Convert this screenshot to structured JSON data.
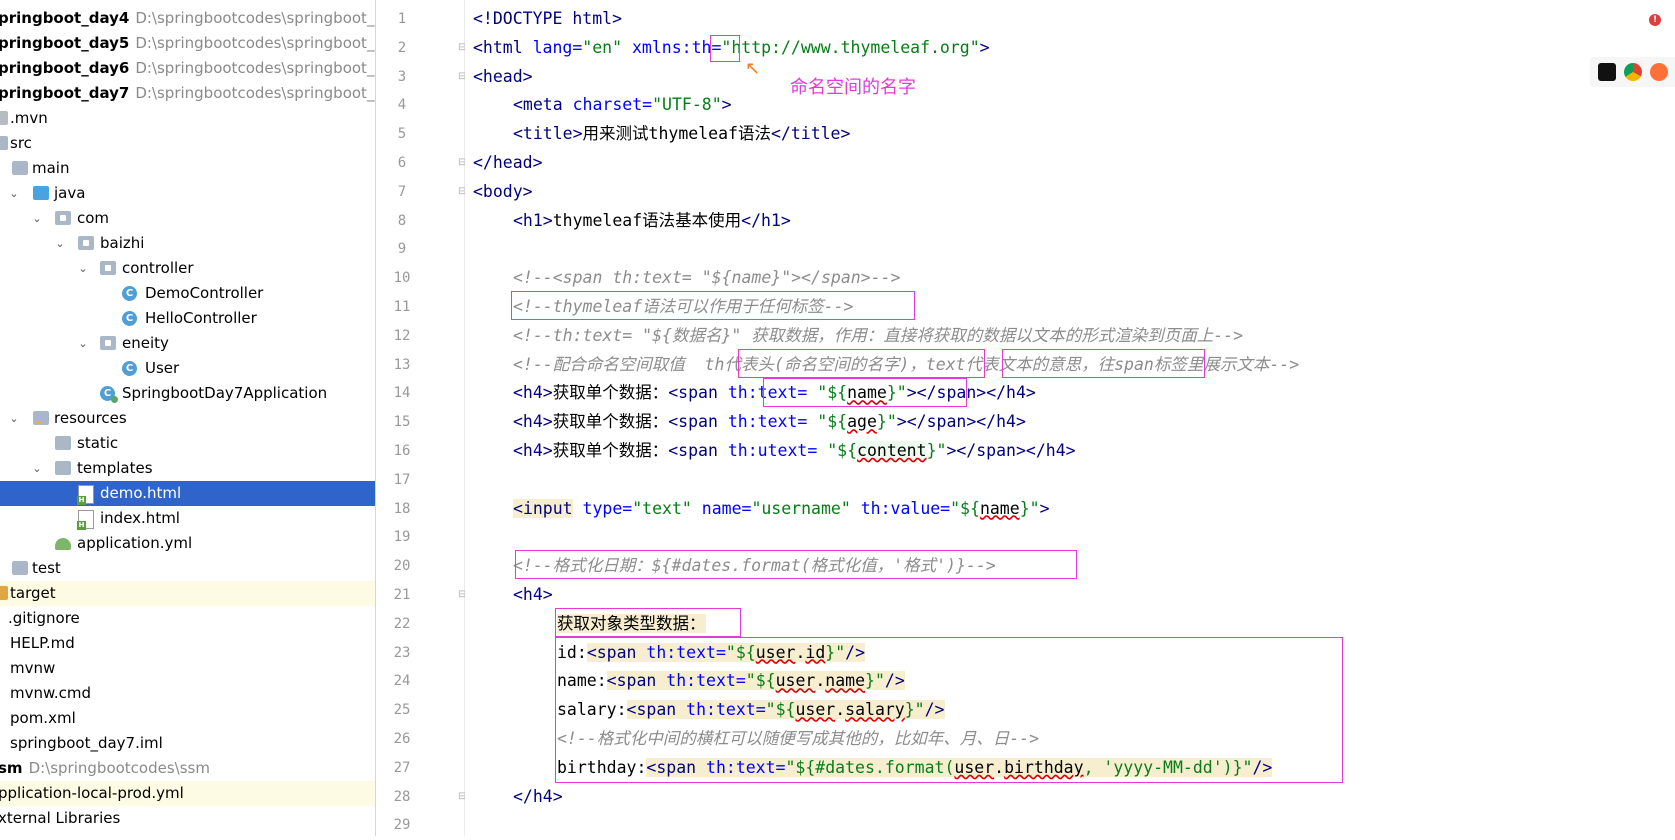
{
  "sidebar": {
    "projects": [
      {
        "name": "pringboot_day4",
        "path": "D:\\springbootcodes\\springboot_day"
      },
      {
        "name": "pringboot_day5",
        "path": "D:\\springbootcodes\\springboot_day"
      },
      {
        "name": "pringboot_day6",
        "path": "D:\\springbootcodes\\springboot_day"
      },
      {
        "name": "pringboot_day7",
        "path": "D:\\springbootcodes\\springboot_day"
      }
    ],
    "tree": [
      {
        "label": ".mvn"
      },
      {
        "label": "src"
      },
      {
        "label": "main"
      },
      {
        "label": "java"
      },
      {
        "label": "com"
      },
      {
        "label": "baizhi"
      },
      {
        "label": "controller"
      },
      {
        "label": "DemoController"
      },
      {
        "label": "HelloController"
      },
      {
        "label": "eneity"
      },
      {
        "label": "User"
      },
      {
        "label": "SpringbootDay7Application"
      },
      {
        "label": "resources"
      },
      {
        "label": "static"
      },
      {
        "label": "templates"
      },
      {
        "label": "demo.html"
      },
      {
        "label": "index.html"
      },
      {
        "label": "application.yml"
      },
      {
        "label": "test"
      },
      {
        "label": "target"
      },
      {
        "label": ".gitignore"
      },
      {
        "label": "HELP.md"
      },
      {
        "label": "mvnw"
      },
      {
        "label": "mvnw.cmd"
      },
      {
        "label": "pom.xml"
      },
      {
        "label": "springboot_day7.iml"
      }
    ],
    "ssm": {
      "name": "sm",
      "path": "D:\\springbootcodes\\ssm"
    },
    "app_local": "pplication-local-prod.yml",
    "ext_libs": "xternal Libraries"
  },
  "editor": {
    "line_numbers": [
      "1",
      "2",
      "3",
      "4",
      "5",
      "6",
      "7",
      "8",
      "9",
      "10",
      "11",
      "12",
      "13",
      "14",
      "15",
      "16",
      "17",
      "18",
      "19",
      "20",
      "21",
      "22",
      "23",
      "24",
      "25",
      "26",
      "27",
      "28",
      "29"
    ],
    "annotation": "命名空间的名字",
    "lines": {
      "l1a": "<!DOCTYPE ",
      "l1b": "html",
      "l1c": ">",
      "l2a": "<html ",
      "l2b": "lang=",
      "l2c": "\"en\"",
      "l2d": " xmlns:",
      "l2e": "th",
      "l2f": "=",
      "l2g": "\"http://www.thymeleaf.org\"",
      "l2h": ">",
      "l3": "<head>",
      "l4a": "<meta ",
      "l4b": "charset=",
      "l4c": "\"UTF-8\"",
      "l4d": ">",
      "l5a": "<title>",
      "l5b": "用来测试thymeleaf语法",
      "l5c": "</title>",
      "l6": "</head>",
      "l7": "<body>",
      "l8a": "<h1>",
      "l8b": "thymeleaf语法基本使用",
      "l8c": "</h1>",
      "l10": "<!--<span th:text= \"${name}\"></span>-->",
      "l11": "<!--thymeleaf语法可以作用于任何标签-->",
      "l12": "<!--th:text= \"${数据名}\" 获取数据，作用：直接将获取的数据以文本的形式渲染到页面上-->",
      "l13a": "<!--配合命名空间取值  ",
      "l13b": "th代表头(命名空间的名字)",
      "l13c": "，",
      "l13d": "text代表文本的意思，",
      "l13e": "往span标签里展示文本-->",
      "l14a": "<h4>",
      "l14b": "获取单个数据：",
      "l14c": "<span ",
      "l14d": "th:text=",
      "l14e": " \"${",
      "l14f": "name",
      "l14g": "}\"",
      "l14h": "></span></h4>",
      "l15a": "<h4>",
      "l15b": "获取单个数据：",
      "l15c": "<span ",
      "l15d": "th:text=",
      "l15e": " \"${",
      "l15f": "age",
      "l15g": "}\"",
      "l15h": "></span></h4>",
      "l16a": "<h4>",
      "l16b": "获取单个数据：",
      "l16c": "<span ",
      "l16d": "th:utext=",
      "l16e": " \"${",
      "l16f": "content",
      "l16g": "}\"",
      "l16h": "></span></h4>",
      "l18a": "<",
      "l18b": "input",
      "l18c": " type=",
      "l18d": "\"text\"",
      "l18e": " name=",
      "l18f": "\"username\"",
      "l18g": " th:value=",
      "l18h": "\"${",
      "l18i": "name",
      "l18j": "}\"",
      "l18k": ">",
      "l20": "<!--格式化日期：${#dates.format(格式化值，'格式')}-->",
      "l21": "<h4>",
      "l22": "获取对象类型数据：",
      "l23a": "id:",
      "l23b": "<span ",
      "l23c": "th:text=",
      "l23d": "\"${",
      "l23e": "user",
      "l23f": ".",
      "l23g": "id",
      "l23h": "}\"",
      "l23i": "/>",
      "l24a": "name:",
      "l24b": "<span ",
      "l24c": "th:text=",
      "l24d": "\"${",
      "l24e": "user",
      "l24f": ".",
      "l24g": "name",
      "l24h": "}\"",
      "l24i": "/>",
      "l25a": "salary:",
      "l25b": "<span ",
      "l25c": "th:text=",
      "l25d": "\"${",
      "l25e": "user",
      "l25f": ".",
      "l25g": "salary",
      "l25h": "}\"",
      "l25i": "/>",
      "l26": "<!--格式化中间的横杠可以随便写成其他的，比如年、月、日-->",
      "l27a": "birthday:",
      "l27b": "<span ",
      "l27c": "th:text=",
      "l27d": "\"${#dates.format(",
      "l27e": "user",
      "l27f": ".",
      "l27g": "birthday",
      "l27h": ", 'yyyy-MM-dd')}\"",
      "l27i": "/>",
      "l28": "</h4>"
    }
  },
  "colors": {
    "accent": "#e23cd5",
    "selection": "#2f65ca"
  }
}
